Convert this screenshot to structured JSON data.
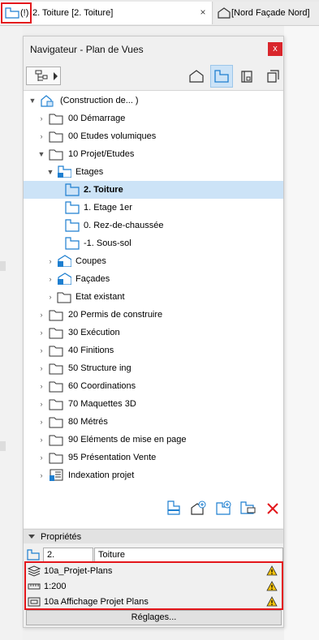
{
  "tabs": {
    "active_prefix": "(!)",
    "active_label": "2. Toiture [2. Toiture]",
    "close_glyph": "×",
    "inactive_label": "[Nord Façade Nord]"
  },
  "panel": {
    "title": "Navigateur - Plan de Vues",
    "close_glyph": "x"
  },
  "tree": {
    "root": "(Construction de... )",
    "items": [
      {
        "label": "00 Démarrage"
      },
      {
        "label": "00 Etudes volumiques"
      },
      {
        "label": "10 Projet/Etudes"
      },
      {
        "label": "Etages"
      },
      {
        "label": "2. Toiture"
      },
      {
        "label": "1. Etage 1er"
      },
      {
        "label": "0. Rez-de-chaussée"
      },
      {
        "label": "-1. Sous-sol"
      },
      {
        "label": "Coupes"
      },
      {
        "label": "Façades"
      },
      {
        "label": "Etat existant"
      },
      {
        "label": "20 Permis de construire"
      },
      {
        "label": "30 Exécution"
      },
      {
        "label": "40 Finitions"
      },
      {
        "label": "50 Structure ing"
      },
      {
        "label": "60 Coordinations"
      },
      {
        "label": "70 Maquettes 3D"
      },
      {
        "label": "80 Métrés"
      },
      {
        "label": "90 Eléments de mise en page"
      },
      {
        "label": "95 Présentation Vente"
      },
      {
        "label": "Indexation projet"
      }
    ]
  },
  "properties": {
    "header": "Propriétés",
    "id_value": "2.",
    "name_value": "Toiture",
    "layer": "10a_Projet-Plans",
    "scale": "1:200",
    "display": "10a Affichage Projet Plans",
    "settings_button": "Réglages..."
  },
  "colors": {
    "highlight_red": "#e3161b",
    "selection_blue": "#cce3f7",
    "icon_blue": "#1e7fd0",
    "warning_yellow": "#f4c20d"
  }
}
